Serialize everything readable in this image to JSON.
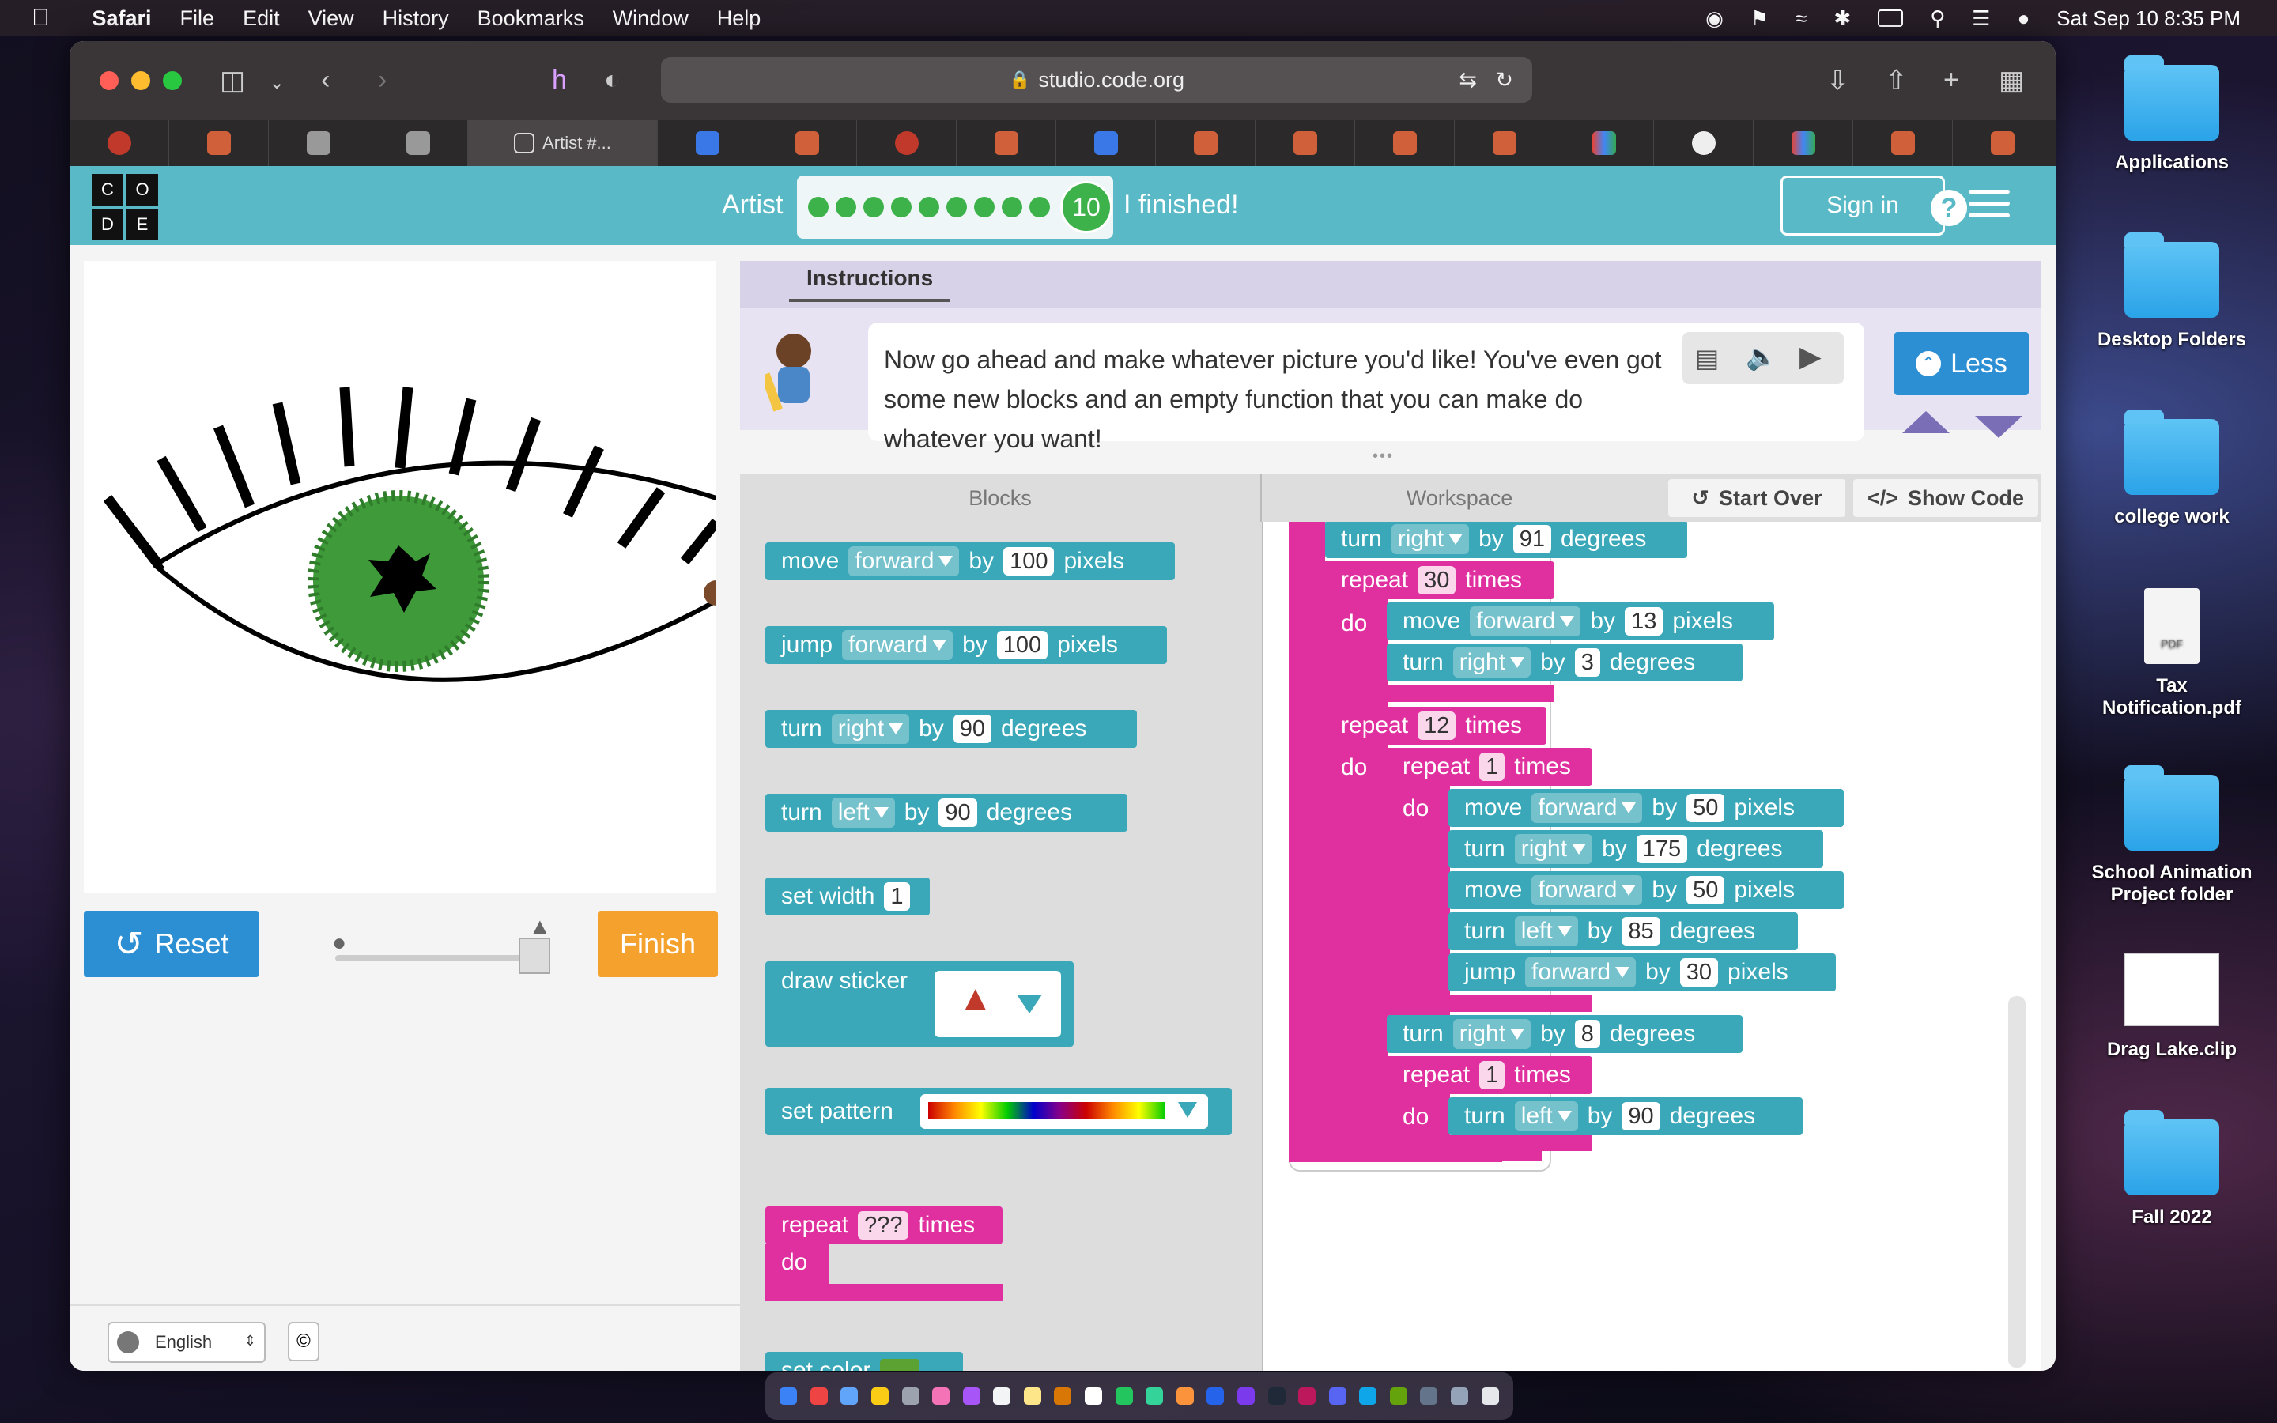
{
  "menubar": {
    "app": "Safari",
    "items": [
      "File",
      "Edit",
      "View",
      "History",
      "Bookmarks",
      "Window",
      "Help"
    ],
    "datetime": "Sat Sep 10  8:35 PM"
  },
  "desktop": {
    "icons": [
      {
        "label": "Applications",
        "kind": "folder"
      },
      {
        "label": "Desktop Folders",
        "kind": "folder"
      },
      {
        "label": "college work",
        "kind": "folder"
      },
      {
        "label": "Tax Notification.pdf",
        "kind": "pdf"
      },
      {
        "label": "School Animation Project folder",
        "kind": "folder"
      },
      {
        "label": "Drag Lake.clip",
        "kind": "clip"
      },
      {
        "label": "Fall 2022",
        "kind": "folder"
      }
    ]
  },
  "browser": {
    "url": "studio.code.org",
    "active_tab": "Artist #...",
    "pdf_badge": "PDF"
  },
  "header": {
    "logo_letters": [
      "C",
      "O",
      "D",
      "E"
    ],
    "title": "Artist",
    "level": "10",
    "finished": "I finished!",
    "sign_in": "Sign in",
    "help": "?"
  },
  "stage": {
    "reset": "Reset",
    "finish": "Finish",
    "speed": 1.0,
    "language": "English",
    "copyright": "©"
  },
  "instructions": {
    "tab": "Instructions",
    "text": "Now go ahead and make whatever picture you'd like! You've even got some new blocks and an empty function that you can make do whatever you want!",
    "less": "Less"
  },
  "workspace": {
    "blocks_header": "Blocks",
    "workspace_header": "Workspace",
    "start_over": "Start Over",
    "show_code": "Show Code"
  },
  "words": {
    "move": "move",
    "jump": "jump",
    "turn": "turn",
    "by": "by",
    "pixels": "pixels",
    "degrees": "degrees",
    "repeat": "repeat",
    "times": "times",
    "do": "do",
    "forward": "forward",
    "right": "right",
    "left": "left",
    "set_width": "set width",
    "draw_sticker": "draw sticker",
    "set_pattern": "set pattern",
    "set_color": "set color",
    "unknown": "???"
  },
  "toolbox_values": {
    "move": "100",
    "jump": "100",
    "turn_right": "90",
    "turn_left": "90",
    "width": "1"
  },
  "program_values": {
    "turn1": "91",
    "rep1": "30",
    "mv1": "13",
    "tr1": "3",
    "rep2": "12",
    "rep3": "1",
    "mv2": "50",
    "tr2": "175",
    "mv3": "50",
    "tl1": "85",
    "jp1": "30",
    "tr3": "8",
    "rep4": "1",
    "tl2": "90"
  },
  "colors": {
    "teal": "#59b9c6",
    "block_teal": "#3aa8b8",
    "block_pink": "#e0309f",
    "block_green": "#5ba233",
    "eye_iris": "#3f9a3a"
  }
}
